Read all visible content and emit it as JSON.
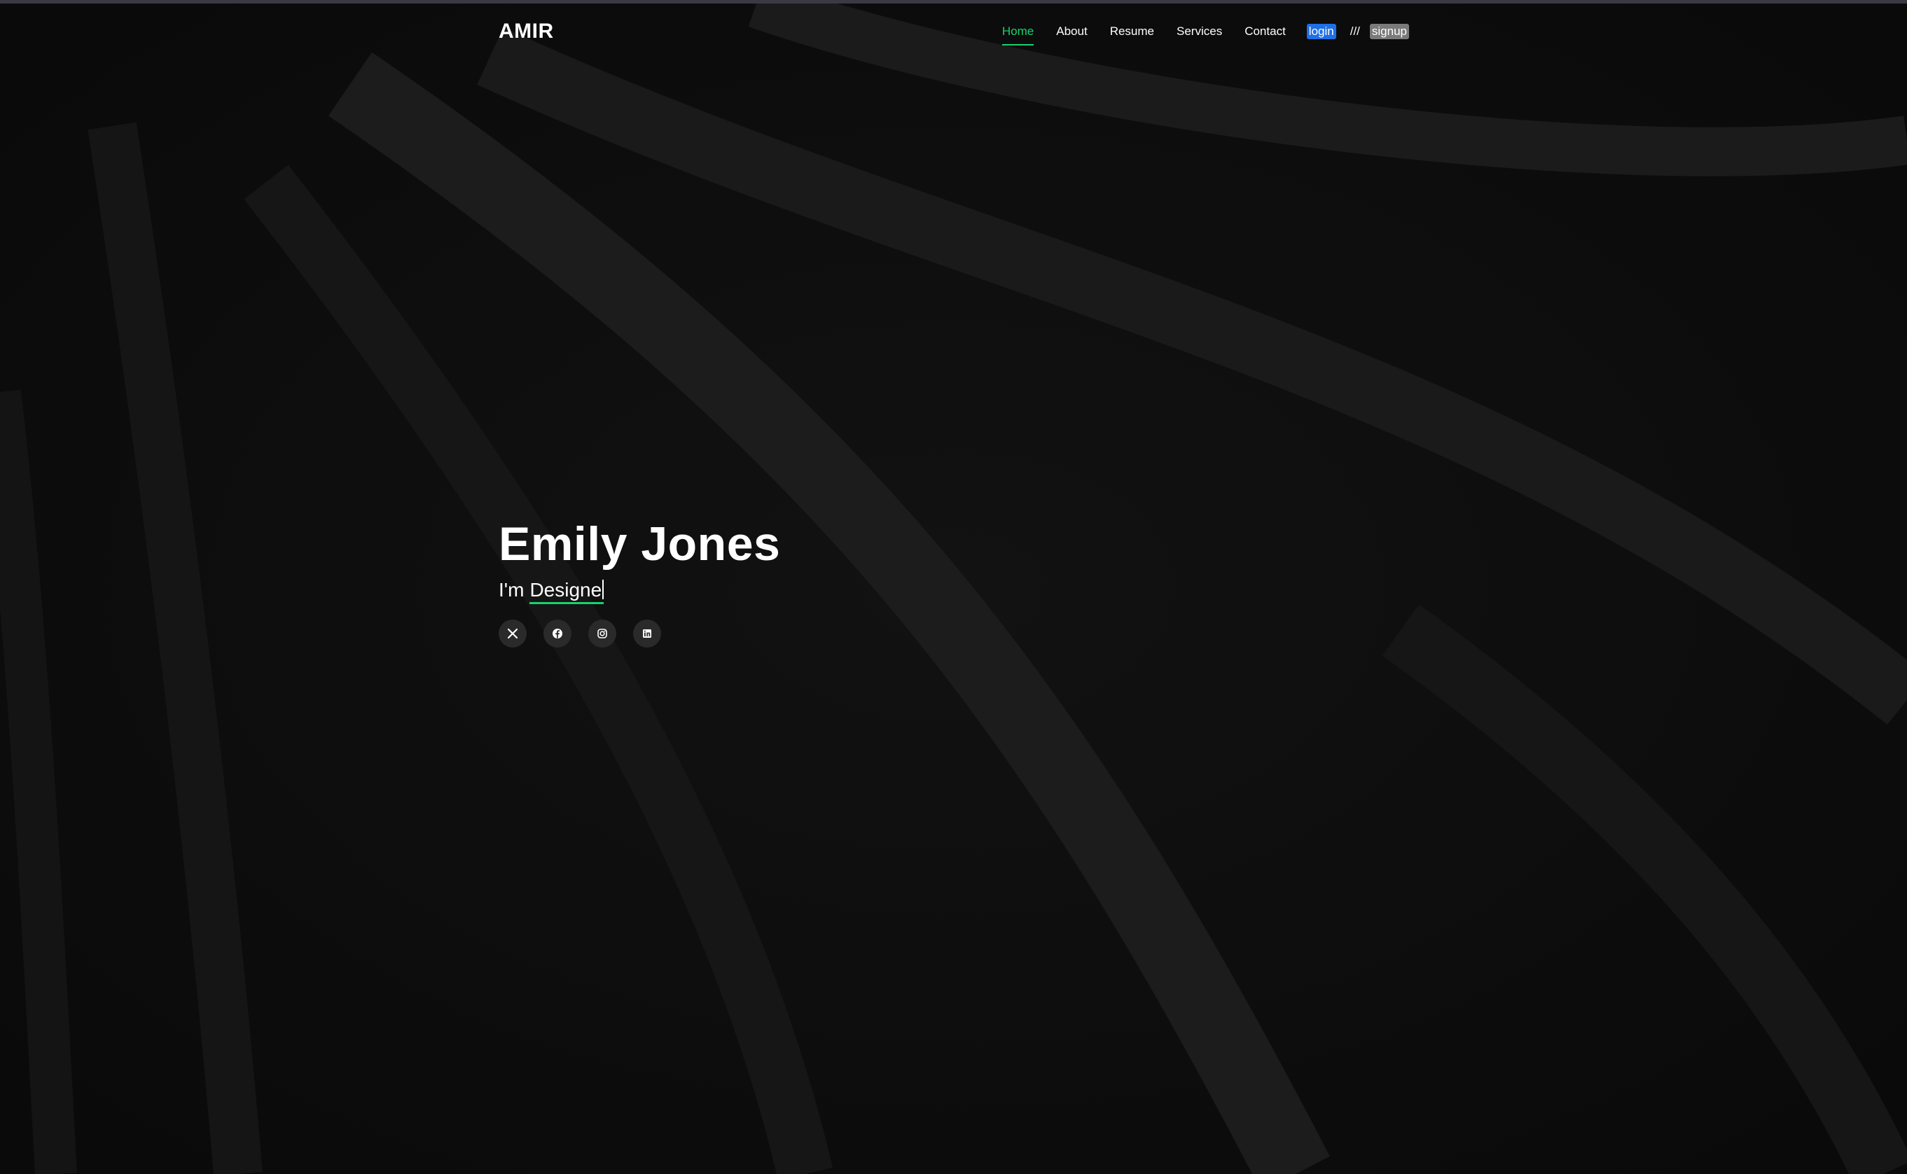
{
  "header": {
    "logo": "AMIR",
    "nav": [
      {
        "label": "Home",
        "active": true
      },
      {
        "label": "About"
      },
      {
        "label": "Resume"
      },
      {
        "label": "Services"
      },
      {
        "label": "Contact"
      }
    ],
    "login_label": "login",
    "separator": "///",
    "signup_label": "signup"
  },
  "hero": {
    "name": "Emily Jones",
    "role_prefix": "I'm",
    "role_word": "Designe",
    "socials": [
      {
        "icon": "x-twitter-icon"
      },
      {
        "icon": "facebook-icon"
      },
      {
        "icon": "instagram-icon"
      },
      {
        "icon": "linkedin-icon"
      }
    ]
  },
  "colors": {
    "accent": "#18d26e",
    "background": "#0e0e0e",
    "login_bg": "#1f6fe5",
    "signup_bg": "#7a7a7a"
  }
}
